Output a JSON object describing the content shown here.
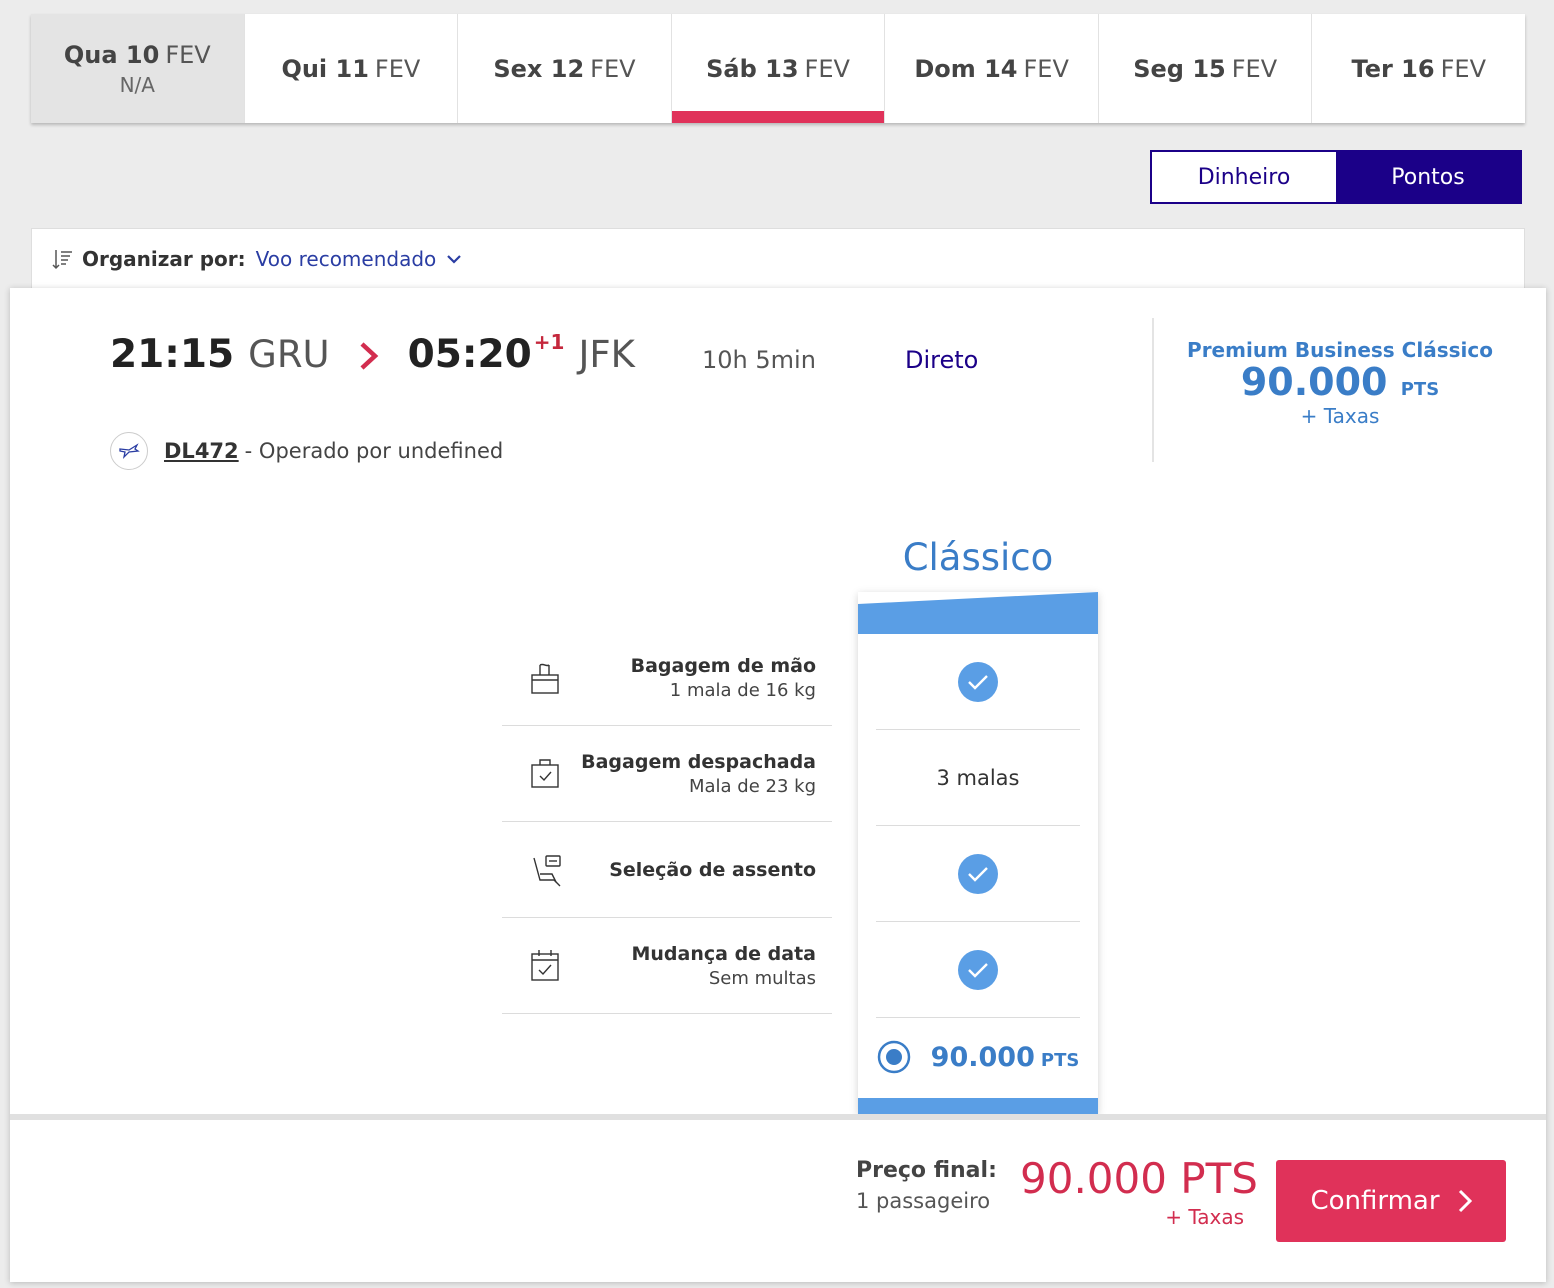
{
  "dates": [
    {
      "day": "Qua 10",
      "month": "FEV",
      "note": "N/A",
      "state": "disabled"
    },
    {
      "day": "Qui 11",
      "month": "FEV",
      "note": "",
      "state": "normal"
    },
    {
      "day": "Sex 12",
      "month": "FEV",
      "note": "",
      "state": "normal"
    },
    {
      "day": "Sáb 13",
      "month": "FEV",
      "note": "",
      "state": "active"
    },
    {
      "day": "Dom 14",
      "month": "FEV",
      "note": "",
      "state": "normal"
    },
    {
      "day": "Seg 15",
      "month": "FEV",
      "note": "",
      "state": "normal"
    },
    {
      "day": "Ter 16",
      "month": "FEV",
      "note": "",
      "state": "normal"
    }
  ],
  "toggle": {
    "money": "Dinheiro",
    "points": "Pontos",
    "selected": "points"
  },
  "sort": {
    "label": "Organizar por:",
    "value": "Voo recomendado"
  },
  "flight": {
    "departure_time": "21:15",
    "departure_airport": "GRU",
    "arrival_time": "05:20",
    "arrival_day_offset": "+1",
    "arrival_airport": "JFK",
    "duration": "10h 5min",
    "stops": "Direto",
    "flight_number": "DL472",
    "operated_by": "- Operado por undefined"
  },
  "fare_summary": {
    "name": "Premium Business Clássico",
    "points": "90.000",
    "unit": "PTS",
    "taxes": "+ Taxas"
  },
  "fare_class": {
    "title": "Clássico",
    "select_points": "90.000",
    "select_unit": "PTS"
  },
  "benefits": [
    {
      "icon": "carry-on-bag-icon",
      "title": "Bagagem de mão",
      "subtitle": "1 mala de 16 kg",
      "value_type": "check",
      "value": ""
    },
    {
      "icon": "checked-bag-icon",
      "title": "Bagagem despachada",
      "subtitle": "Mala de 23 kg",
      "value_type": "text",
      "value": "3 malas"
    },
    {
      "icon": "seat-icon",
      "title": "Seleção de assento",
      "subtitle": "",
      "value_type": "check",
      "value": ""
    },
    {
      "icon": "calendar-change-icon",
      "title": "Mudança de data",
      "subtitle": "Sem multas",
      "value_type": "check",
      "value": ""
    }
  ],
  "footer": {
    "label": "Preço final:",
    "passengers": "1 passageiro",
    "price": "90.000 PTS",
    "taxes": "+ Taxas",
    "confirm": "Confirmar"
  },
  "colors": {
    "accent_red": "#e0325a",
    "navy": "#1b0088",
    "fare_blue": "#3a7dc7",
    "check_blue": "#5a9ee5"
  }
}
